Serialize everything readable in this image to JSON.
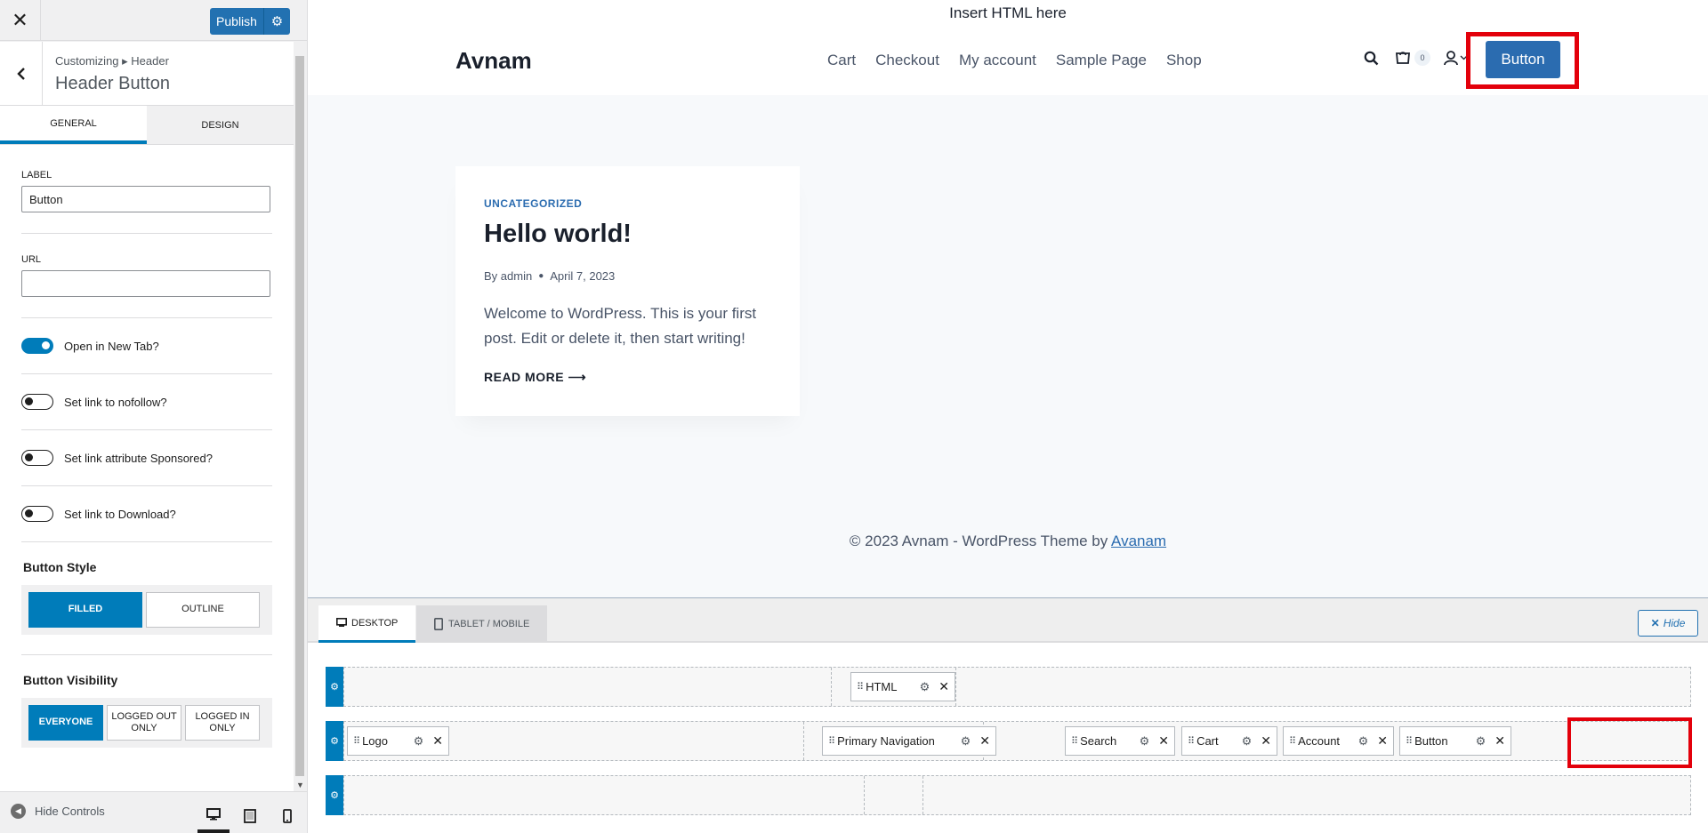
{
  "customizer": {
    "publish_label": "Publish",
    "breadcrumb": "Customizing ▸ Header",
    "section_title": "Header Button",
    "tabs": [
      {
        "label": "General"
      },
      {
        "label": "Design"
      }
    ],
    "label_field": {
      "label": "Label",
      "value": "Button"
    },
    "url_field": {
      "label": "URL",
      "value": ""
    },
    "toggles": [
      {
        "label": "Open in New Tab?",
        "on": true
      },
      {
        "label": "Set link to nofollow?",
        "on": false
      },
      {
        "label": "Set link attribute Sponsored?",
        "on": false
      },
      {
        "label": "Set link to Download?",
        "on": false
      }
    ],
    "button_style": {
      "title": "Button Style",
      "options": [
        "Filled",
        "Outline"
      ],
      "selected": "Filled"
    },
    "button_visibility": {
      "title": "Button Visibility",
      "options": [
        "Everyone",
        "Logged Out Only",
        "Logged In Only"
      ],
      "selected": "Everyone"
    },
    "footer": {
      "hide_controls_label": "Hide Controls"
    }
  },
  "preview": {
    "top_html": "Insert HTML here",
    "logo": "Avnam",
    "nav": [
      "Cart",
      "Checkout",
      "My account",
      "Sample Page",
      "Shop"
    ],
    "cart_count": "0",
    "header_button": "Button",
    "post": {
      "category": "Uncategorized",
      "title": "Hello world!",
      "author_prefix": "By",
      "author": "admin",
      "date": "April 7, 2023",
      "excerpt": "Welcome to WordPress. This is your first post. Edit or delete it, then start writing!",
      "read_more": "Read More ⟶"
    },
    "footer": {
      "text": "© 2023 Avnam - WordPress Theme by ",
      "link": "Avanam"
    }
  },
  "builder": {
    "tabs": [
      {
        "label": "Desktop"
      },
      {
        "label": "Tablet / Mobile"
      }
    ],
    "hide_label": "Hide",
    "top_row": {
      "center": [
        "HTML"
      ]
    },
    "main_row": {
      "left": [
        "Logo"
      ],
      "center": [
        "Primary Navigation"
      ],
      "right": [
        "Search",
        "Cart",
        "Account",
        "Button"
      ]
    }
  },
  "colors": {
    "wp_blue": "#2271b1",
    "accent": "#007cba",
    "site_button": "#2b6cb0",
    "highlight": "#e3000b"
  }
}
